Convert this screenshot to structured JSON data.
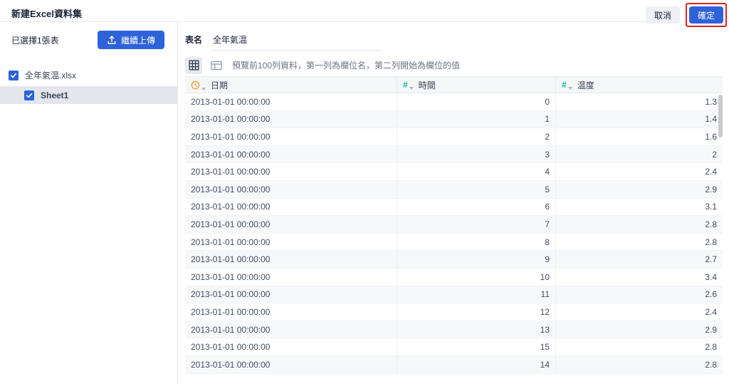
{
  "header": {
    "title": "新建Excel資料集",
    "cancel_label": "取消",
    "confirm_label": "確定",
    "accent_color": "#2e62d9",
    "annotation_color": "#d9251c"
  },
  "sidebar": {
    "selected_count_text": "已選擇1張表",
    "upload_button_label": "繼續上傳",
    "file": {
      "name": "全年氣温.xlsx",
      "checked": true
    },
    "sheet": {
      "name": "Sheet1",
      "checked": true,
      "selected": true
    }
  },
  "main": {
    "table_name_label": "表名",
    "table_name_value": "全年氣温",
    "preview_hint": "預覽前100列資料，第一列為欄位名，第二列開始為欄位的值"
  },
  "table": {
    "columns": [
      {
        "label": "日期",
        "type": "datetime",
        "icon": "clock-icon",
        "icon_color": "#efa030",
        "align": "left"
      },
      {
        "label": "時間",
        "type": "number",
        "icon": "hash-icon",
        "icon_color": "#12b899",
        "align": "right"
      },
      {
        "label": "温度",
        "type": "number",
        "icon": "hash-icon",
        "icon_color": "#12b899",
        "align": "right"
      }
    ],
    "rows": [
      [
        "2013-01-01 00:00:00",
        "0",
        "1.3"
      ],
      [
        "2013-01-01 00:00:00",
        "1",
        "1.4"
      ],
      [
        "2013-01-01 00:00:00",
        "2",
        "1.6"
      ],
      [
        "2013-01-01 00:00:00",
        "3",
        "2"
      ],
      [
        "2013-01-01 00:00:00",
        "4",
        "2.4"
      ],
      [
        "2013-01-01 00:00:00",
        "5",
        "2.9"
      ],
      [
        "2013-01-01 00:00:00",
        "6",
        "3.1"
      ],
      [
        "2013-01-01 00:00:00",
        "7",
        "2.8"
      ],
      [
        "2013-01-01 00:00:00",
        "8",
        "2.8"
      ],
      [
        "2013-01-01 00:00:00",
        "9",
        "2.7"
      ],
      [
        "2013-01-01 00:00:00",
        "10",
        "3.4"
      ],
      [
        "2013-01-01 00:00:00",
        "11",
        "2.6"
      ],
      [
        "2013-01-01 00:00:00",
        "12",
        "2.4"
      ],
      [
        "2013-01-01 00:00:00",
        "13",
        "2.9"
      ],
      [
        "2013-01-01 00:00:00",
        "15",
        "2.8"
      ],
      [
        "2013-01-01 00:00:00",
        "14",
        "2.8"
      ]
    ]
  }
}
